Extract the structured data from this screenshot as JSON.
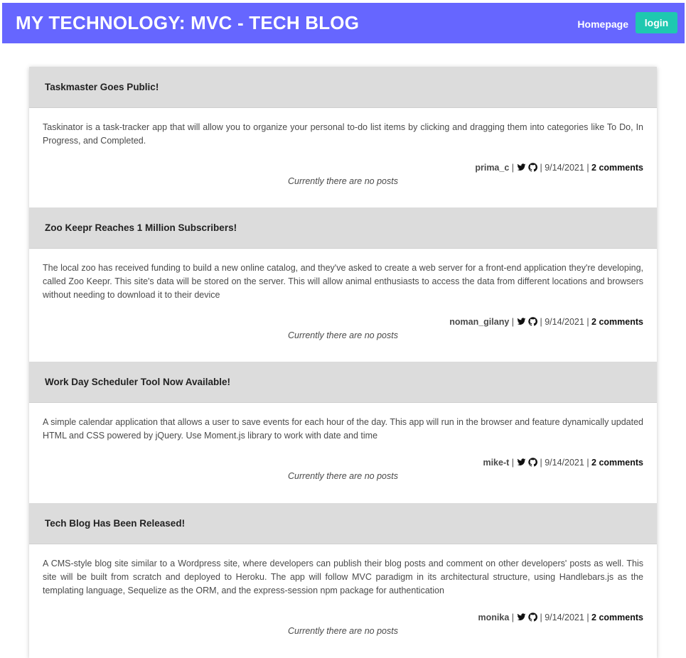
{
  "navbar": {
    "brand": "MY TECHNOLOGY: MVC - TECH BLOG",
    "homepage_label": "Homepage",
    "login_label": "login"
  },
  "posts": [
    {
      "title": "Taskmaster Goes Public!",
      "content": "Taskinator is a task-tracker app that will allow you to organize your personal to-do list items by clicking and dragging them into categories like To Do, In Progress, and Completed.",
      "author": "prima_c",
      "separator": "|",
      "date": "9/14/2021",
      "comments": "2 comments",
      "no_posts_text": "Currently there are no posts"
    },
    {
      "title": "Zoo Keepr Reaches 1 Million Subscribers!",
      "content": "The local zoo has received funding to build a new online catalog, and they've asked to create a web server for a front-end application they're developing, called Zoo Keepr. This site's data will be stored on the server. This will allow animal enthusiasts to access the data from different locations and browsers without needing to download it to their device",
      "author": "noman_gilany",
      "separator": "|",
      "date": "9/14/2021",
      "comments": "2 comments",
      "no_posts_text": "Currently there are no posts"
    },
    {
      "title": "Work Day Scheduler Tool Now Available!",
      "content": "A simple calendar application that allows a user to save events for each hour of the day. This app will run in the browser and feature dynamically updated HTML and CSS powered by jQuery. Use Moment.js library to work with date and time",
      "author": "mike-t",
      "separator": "|",
      "date": "9/14/2021",
      "comments": "2 comments",
      "no_posts_text": "Currently there are no posts"
    },
    {
      "title": "Tech Blog Has Been Released!",
      "content": "A CMS-style blog site similar to a Wordpress site, where developers can publish their blog posts and comment on other developers' posts as well. This site will be built from scratch and deployed to Heroku. The app will follow MVC paradigm in its architectural structure, using Handlebars.js as the templating language, Sequelize as the ORM, and the express-session npm package for authentication",
      "author": "monika",
      "separator": "|",
      "date": "9/14/2021",
      "comments": "2 comments",
      "no_posts_text": "Currently there are no posts"
    }
  ],
  "icons": {
    "twitter": "twitter-icon",
    "github": "github-icon"
  },
  "colors": {
    "navbar_bg": "#6666ff",
    "login_bg": "#1ec8b0",
    "post_header_bg": "#dcdcdc"
  }
}
